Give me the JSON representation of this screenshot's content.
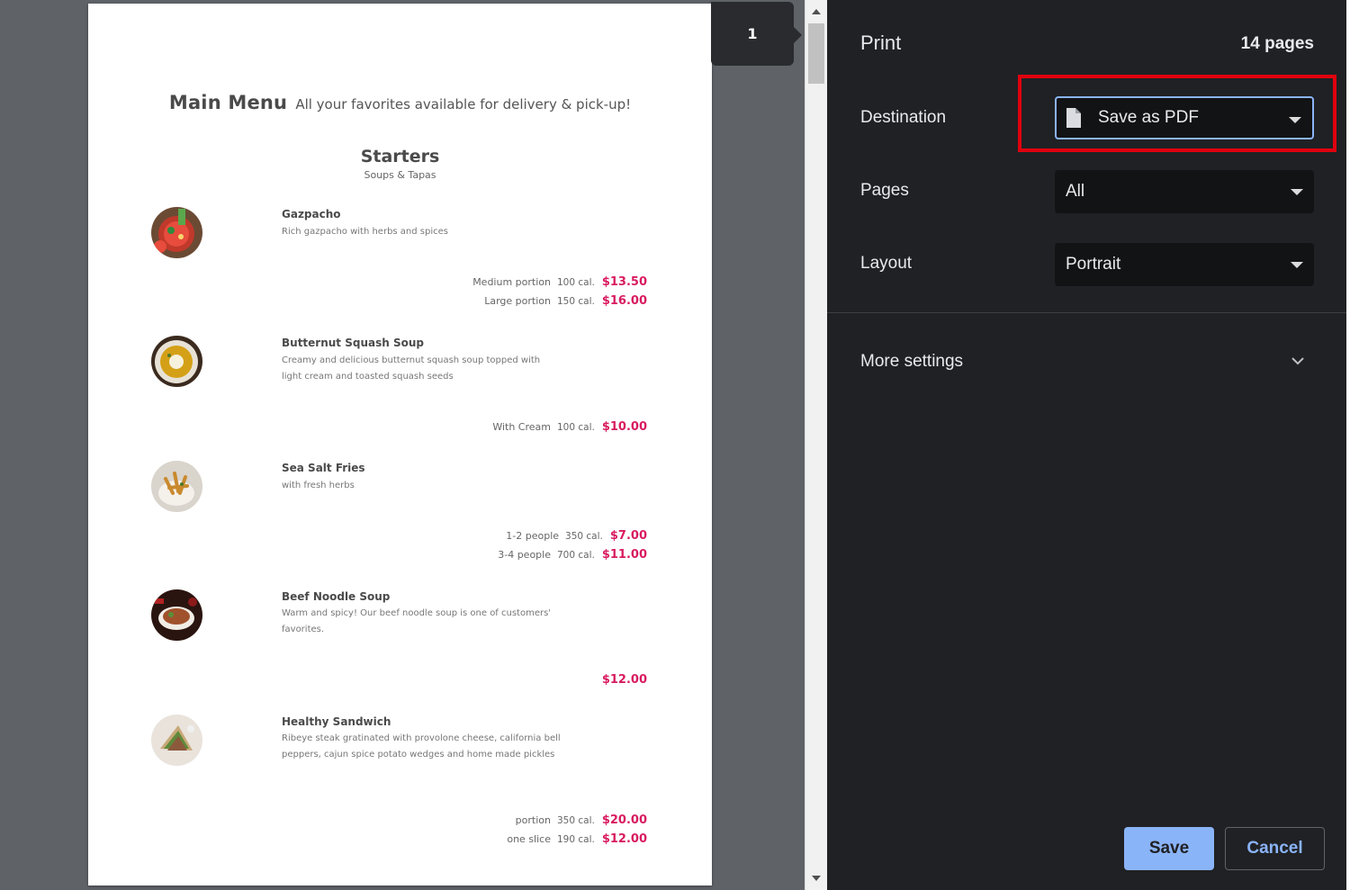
{
  "preview": {
    "page_number": "1",
    "menu": {
      "title": "Main Menu",
      "subtitle": "All your favorites available for delivery & pick-up!",
      "section_title": "Starters",
      "section_subtitle": "Soups & Tapas",
      "items": [
        {
          "name": "Gazpacho",
          "description": "Rich gazpacho with herbs and spices",
          "image": "gazpacho-photo",
          "prices": [
            {
              "label": "Medium portion",
              "cal": "100 cal.",
              "price": "$13.50"
            },
            {
              "label": "Large portion",
              "cal": "150 cal.",
              "price": "$16.00"
            }
          ]
        },
        {
          "name": "Butternut Squash Soup",
          "description": "Creamy and delicious butternut squash soup topped with light cream and toasted squash seeds",
          "image": "squash-soup-photo",
          "prices": [
            {
              "label": "With Cream",
              "cal": "100 cal.",
              "price": "$10.00"
            }
          ]
        },
        {
          "name": "Sea Salt Fries",
          "description": "with fresh herbs",
          "image": "fries-photo",
          "prices": [
            {
              "label": "1-2 people",
              "cal": "350 cal.",
              "price": "$7.00"
            },
            {
              "label": "3-4 people",
              "cal": "700 cal.",
              "price": "$11.00"
            }
          ]
        },
        {
          "name": "Beef Noodle Soup",
          "description": "Warm and spicy! Our beef noodle soup is one of customers' favorites.",
          "image": "noodle-soup-photo",
          "prices": [
            {
              "label": "",
              "cal": "",
              "price": "$12.00"
            }
          ]
        },
        {
          "name": "Healthy Sandwich",
          "description": "Ribeye steak gratinated with provolone cheese, california bell peppers, cajun spice potato wedges and home made pickles",
          "image": "sandwich-photo",
          "prices": [
            {
              "label": "portion",
              "cal": "350 cal.",
              "price": "$20.00"
            },
            {
              "label": "one slice",
              "cal": "190 cal.",
              "price": "$12.00"
            }
          ]
        }
      ]
    }
  },
  "settings": {
    "title": "Print",
    "sheet_count": "14 pages",
    "destination": {
      "label": "Destination",
      "value": "Save as PDF",
      "icon": "file-icon"
    },
    "pages": {
      "label": "Pages",
      "value": "All"
    },
    "layout": {
      "label": "Layout",
      "value": "Portrait"
    },
    "more_settings": {
      "label": "More settings",
      "icon": "chevron-down-icon"
    },
    "save_label": "Save",
    "cancel_label": "Cancel"
  },
  "colors": {
    "panel_bg": "#202124",
    "accent": "#8ab4f8",
    "price": "#d81b60",
    "highlight": "#e0000e"
  }
}
